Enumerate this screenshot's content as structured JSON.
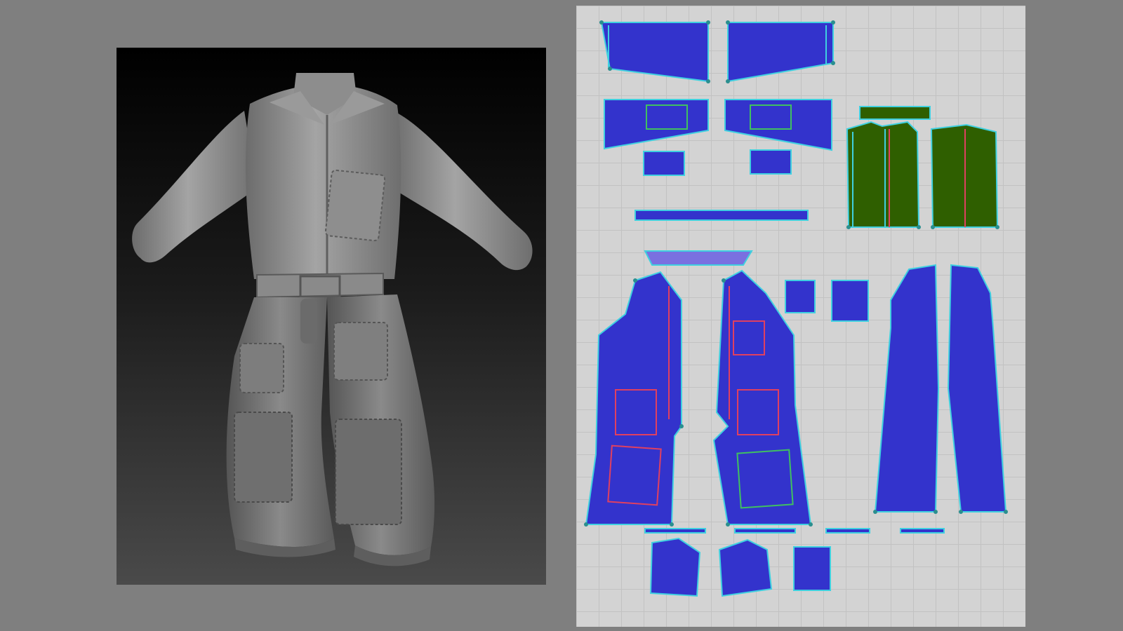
{
  "render_view": {
    "subject": "coverall-jumpsuit-sculpt"
  },
  "pattern_view": {
    "colors": {
      "grid_background": "#d3d3d3",
      "grid_line": "#c2c2c2",
      "piece_fill_blue": "#3333cc",
      "piece_fill_green": "#2f5f00",
      "seam_cyan": "#3fd0e0",
      "seam_red": "#e04060",
      "seam_green": "#40c060",
      "point_teal": "#2a8f8f"
    },
    "pieces": [
      {
        "name": "cuff-left"
      },
      {
        "name": "cuff-right"
      },
      {
        "name": "chest-pocket-left"
      },
      {
        "name": "chest-pocket-right"
      },
      {
        "name": "pocket-flap-left"
      },
      {
        "name": "pocket-flap-right"
      },
      {
        "name": "belt-strip"
      },
      {
        "name": "collar-band"
      },
      {
        "name": "collar"
      },
      {
        "name": "back-yoke-green"
      },
      {
        "name": "sleeve-green-left"
      },
      {
        "name": "sleeve-green-right"
      },
      {
        "name": "front-panel-left"
      },
      {
        "name": "front-panel-right"
      },
      {
        "name": "small-patch-a"
      },
      {
        "name": "small-patch-b"
      },
      {
        "name": "back-panel-left"
      },
      {
        "name": "back-panel-right"
      },
      {
        "name": "knee-patch-left"
      },
      {
        "name": "knee-patch-center"
      },
      {
        "name": "knee-patch-right"
      }
    ]
  }
}
